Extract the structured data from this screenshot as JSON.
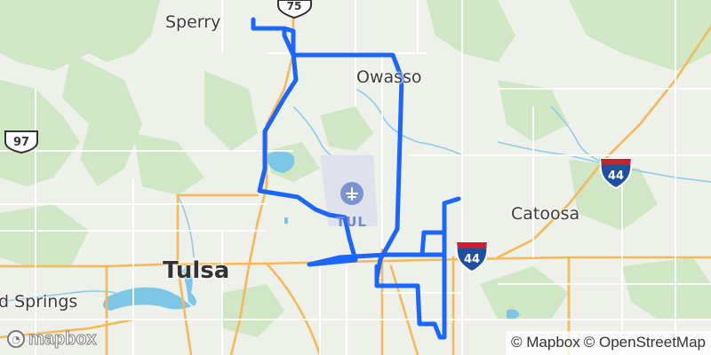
{
  "map": {
    "labels": {
      "sperry": "Sperry",
      "owasso": "Owasso",
      "catoosa": "Catoosa",
      "tulsa": "Tulsa",
      "sand_springs": "d Springs",
      "airport": "TUL"
    },
    "shields": {
      "us75": "75",
      "us97": "97",
      "i44_east": "44",
      "i44_center": "44"
    },
    "route_color": "#1a66ff",
    "attribution": {
      "mapbox": "© Mapbox",
      "osm": "© OpenStreetMap"
    },
    "logo_text": "mapbox",
    "colors": {
      "land": "#eef0ea",
      "park": "#c7e3bd",
      "water": "#74c3e4",
      "highway": "#f7b857",
      "road": "#ffffff"
    }
  }
}
